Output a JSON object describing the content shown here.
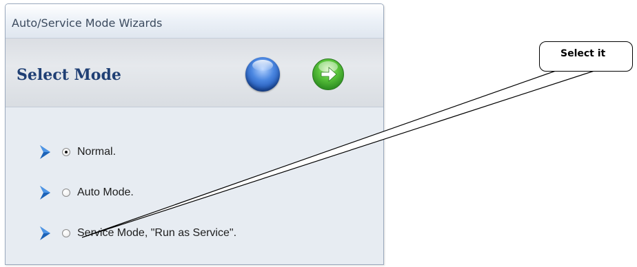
{
  "window": {
    "title": "Auto/Service Mode Wizards"
  },
  "header": {
    "title": "Select Mode"
  },
  "options": [
    {
      "label": "Normal.",
      "checked": true
    },
    {
      "label": "Auto Mode.",
      "checked": false
    },
    {
      "label": "Service Mode, \"Run as Service\".",
      "checked": false
    }
  ],
  "annotation": {
    "text": "Select it"
  },
  "icons": {
    "orb": "blue-orb-icon",
    "next": "green-arrow-right-icon",
    "bullet": "blue-chevron-icon"
  },
  "colors": {
    "header_title": "#1f3f74",
    "chevron": "#1c63b8",
    "next_green": "#3aa32c"
  }
}
